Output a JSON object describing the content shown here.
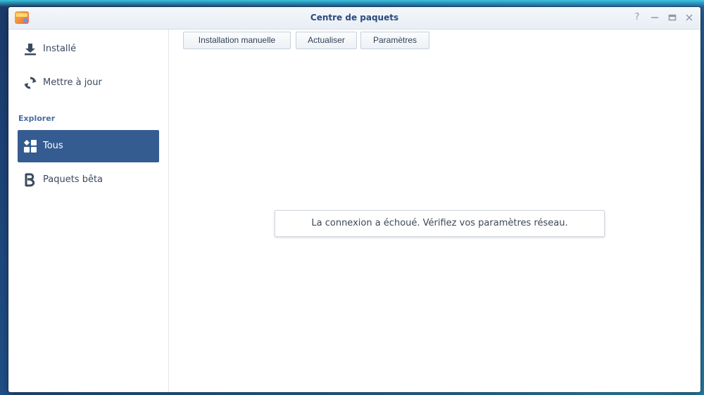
{
  "window": {
    "title": "Centre de paquets",
    "controls": [
      "help-icon",
      "minimize-icon",
      "maximize-icon",
      "close-icon"
    ]
  },
  "sidebar": {
    "items": [
      {
        "label": "Installé",
        "icon": "download-icon"
      },
      {
        "label": "Mettre à jour",
        "icon": "refresh-icon"
      }
    ],
    "section_label": "Explorer",
    "explore_items": [
      {
        "label": "Tous",
        "icon": "grid-icon",
        "active": true
      },
      {
        "label": "Paquets bêta",
        "icon": "beta-icon",
        "active": false
      }
    ]
  },
  "toolbar": {
    "manual_install_label": "Installation manuelle",
    "refresh_label": "Actualiser",
    "settings_label": "Paramètres"
  },
  "main": {
    "message": "La connexion a échoué. Vérifiez vos paramètres réseau."
  },
  "colors": {
    "accent": "#355c91",
    "title_text": "#2b4a7a",
    "section_text": "#4b6da0"
  }
}
